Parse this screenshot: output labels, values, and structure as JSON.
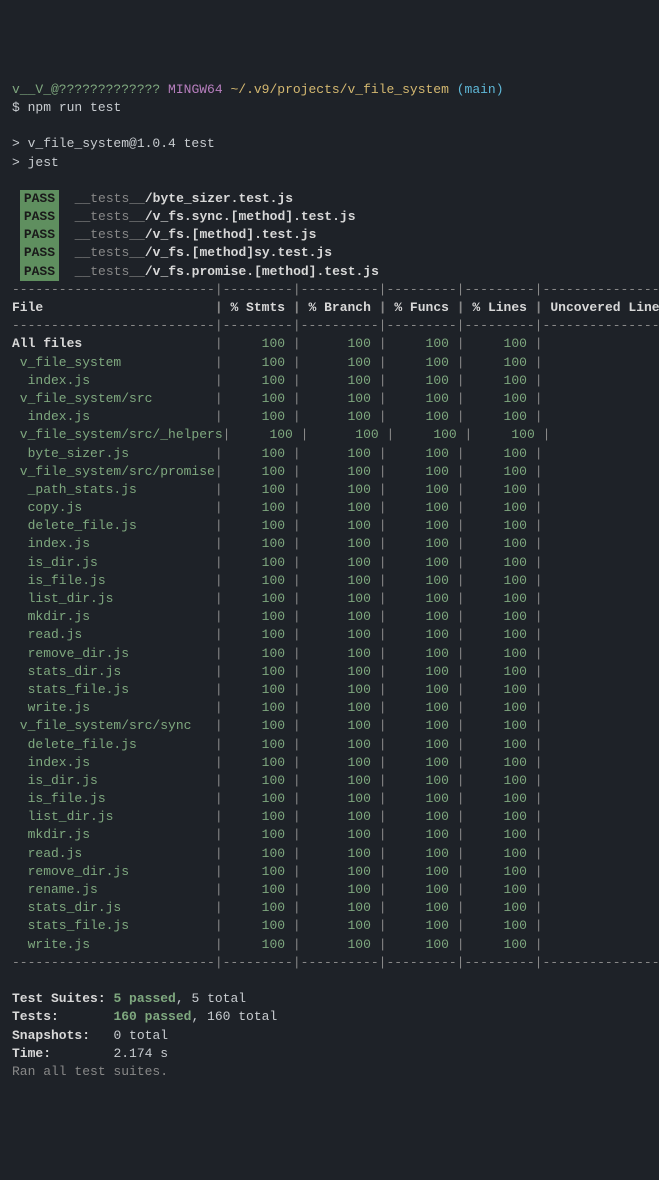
{
  "prompt": {
    "user": "v__V_@?????????????",
    "shell": "MINGW64",
    "path": "~/.v9/projects/v_file_system",
    "branch": "(main)",
    "dollar": "$",
    "command": "npm run test"
  },
  "run_header": {
    "line1": "> v_file_system@1.0.4 test",
    "line2": "> jest"
  },
  "pass_label": "PASS",
  "tests_prefix": "__tests__",
  "test_files": [
    "/byte_sizer.test.js",
    "/v_fs.sync.[method].test.js",
    "/v_fs.[method].test.js",
    "/v_fs.[method]sy.test.js",
    "/v_fs.promise.[method].test.js"
  ],
  "coverage_headers": [
    "File",
    "% Stmts",
    "% Branch",
    "% Funcs",
    "% Lines",
    "Uncovered Line #s"
  ],
  "coverage_rows": [
    {
      "name": "All files",
      "indent": 0,
      "stmts": "100",
      "branch": "100",
      "funcs": "100",
      "lines": "100"
    },
    {
      "name": "v_file_system",
      "indent": 1,
      "stmts": "100",
      "branch": "100",
      "funcs": "100",
      "lines": "100"
    },
    {
      "name": "index.js",
      "indent": 2,
      "stmts": "100",
      "branch": "100",
      "funcs": "100",
      "lines": "100"
    },
    {
      "name": "v_file_system/src",
      "indent": 1,
      "stmts": "100",
      "branch": "100",
      "funcs": "100",
      "lines": "100"
    },
    {
      "name": "index.js",
      "indent": 2,
      "stmts": "100",
      "branch": "100",
      "funcs": "100",
      "lines": "100"
    },
    {
      "name": "v_file_system/src/_helpers",
      "indent": 1,
      "stmts": "100",
      "branch": "100",
      "funcs": "100",
      "lines": "100"
    },
    {
      "name": "byte_sizer.js",
      "indent": 2,
      "stmts": "100",
      "branch": "100",
      "funcs": "100",
      "lines": "100"
    },
    {
      "name": "v_file_system/src/promise",
      "indent": 1,
      "stmts": "100",
      "branch": "100",
      "funcs": "100",
      "lines": "100"
    },
    {
      "name": "_path_stats.js",
      "indent": 2,
      "stmts": "100",
      "branch": "100",
      "funcs": "100",
      "lines": "100"
    },
    {
      "name": "copy.js",
      "indent": 2,
      "stmts": "100",
      "branch": "100",
      "funcs": "100",
      "lines": "100"
    },
    {
      "name": "delete_file.js",
      "indent": 2,
      "stmts": "100",
      "branch": "100",
      "funcs": "100",
      "lines": "100"
    },
    {
      "name": "index.js",
      "indent": 2,
      "stmts": "100",
      "branch": "100",
      "funcs": "100",
      "lines": "100"
    },
    {
      "name": "is_dir.js",
      "indent": 2,
      "stmts": "100",
      "branch": "100",
      "funcs": "100",
      "lines": "100"
    },
    {
      "name": "is_file.js",
      "indent": 2,
      "stmts": "100",
      "branch": "100",
      "funcs": "100",
      "lines": "100"
    },
    {
      "name": "list_dir.js",
      "indent": 2,
      "stmts": "100",
      "branch": "100",
      "funcs": "100",
      "lines": "100"
    },
    {
      "name": "mkdir.js",
      "indent": 2,
      "stmts": "100",
      "branch": "100",
      "funcs": "100",
      "lines": "100"
    },
    {
      "name": "read.js",
      "indent": 2,
      "stmts": "100",
      "branch": "100",
      "funcs": "100",
      "lines": "100"
    },
    {
      "name": "remove_dir.js",
      "indent": 2,
      "stmts": "100",
      "branch": "100",
      "funcs": "100",
      "lines": "100"
    },
    {
      "name": "stats_dir.js",
      "indent": 2,
      "stmts": "100",
      "branch": "100",
      "funcs": "100",
      "lines": "100"
    },
    {
      "name": "stats_file.js",
      "indent": 2,
      "stmts": "100",
      "branch": "100",
      "funcs": "100",
      "lines": "100"
    },
    {
      "name": "write.js",
      "indent": 2,
      "stmts": "100",
      "branch": "100",
      "funcs": "100",
      "lines": "100"
    },
    {
      "name": "v_file_system/src/sync",
      "indent": 1,
      "stmts": "100",
      "branch": "100",
      "funcs": "100",
      "lines": "100"
    },
    {
      "name": "delete_file.js",
      "indent": 2,
      "stmts": "100",
      "branch": "100",
      "funcs": "100",
      "lines": "100"
    },
    {
      "name": "index.js",
      "indent": 2,
      "stmts": "100",
      "branch": "100",
      "funcs": "100",
      "lines": "100"
    },
    {
      "name": "is_dir.js",
      "indent": 2,
      "stmts": "100",
      "branch": "100",
      "funcs": "100",
      "lines": "100"
    },
    {
      "name": "is_file.js",
      "indent": 2,
      "stmts": "100",
      "branch": "100",
      "funcs": "100",
      "lines": "100"
    },
    {
      "name": "list_dir.js",
      "indent": 2,
      "stmts": "100",
      "branch": "100",
      "funcs": "100",
      "lines": "100"
    },
    {
      "name": "mkdir.js",
      "indent": 2,
      "stmts": "100",
      "branch": "100",
      "funcs": "100",
      "lines": "100"
    },
    {
      "name": "read.js",
      "indent": 2,
      "stmts": "100",
      "branch": "100",
      "funcs": "100",
      "lines": "100"
    },
    {
      "name": "remove_dir.js",
      "indent": 2,
      "stmts": "100",
      "branch": "100",
      "funcs": "100",
      "lines": "100"
    },
    {
      "name": "rename.js",
      "indent": 2,
      "stmts": "100",
      "branch": "100",
      "funcs": "100",
      "lines": "100"
    },
    {
      "name": "stats_dir.js",
      "indent": 2,
      "stmts": "100",
      "branch": "100",
      "funcs": "100",
      "lines": "100"
    },
    {
      "name": "stats_file.js",
      "indent": 2,
      "stmts": "100",
      "branch": "100",
      "funcs": "100",
      "lines": "100"
    },
    {
      "name": "write.js",
      "indent": 2,
      "stmts": "100",
      "branch": "100",
      "funcs": "100",
      "lines": "100"
    }
  ],
  "summary": {
    "suites_label": "Test Suites:",
    "suites_passed": "5 passed",
    "suites_total": ", 5 total",
    "tests_label": "Tests:",
    "tests_passed": "160 passed",
    "tests_total": ", 160 total",
    "snapshots_label": "Snapshots:",
    "snapshots_value": "0 total",
    "time_label": "Time:",
    "time_value": "2.174 s",
    "ran_msg": "Ran all test suites."
  }
}
